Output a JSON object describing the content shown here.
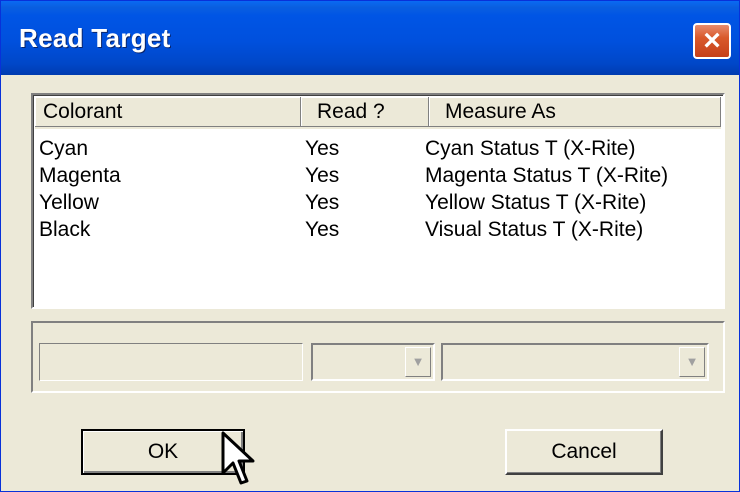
{
  "window": {
    "title": "Read Target"
  },
  "list": {
    "columns": [
      "Colorant",
      "Read ?",
      "Measure As"
    ],
    "rows": [
      [
        "Cyan",
        "Yes",
        "Cyan Status T (X-Rite)"
      ],
      [
        "Magenta",
        "Yes",
        "Magenta Status T (X-Rite)"
      ],
      [
        "Yellow",
        "Yes",
        "Yellow Status T (X-Rite)"
      ],
      [
        "Black",
        "Yes",
        "Visual Status T (X-Rite)"
      ]
    ]
  },
  "buttons": {
    "ok": "OK",
    "cancel": "Cancel"
  },
  "icons": {
    "close": "close-icon",
    "dropdown": "chevron-down-icon",
    "cursor": "mouse-pointer-icon"
  }
}
